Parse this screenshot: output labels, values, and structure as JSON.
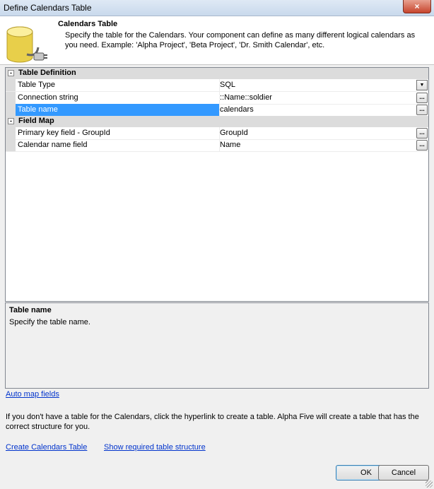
{
  "window": {
    "title": "Define Calendars Table",
    "close_label": "×"
  },
  "header": {
    "title": "Calendars Table",
    "description": "Specify the table for the Calendars. Your component can define as many different logical calendars as you need. Example: 'Alpha Project', 'Beta Project', 'Dr. Smith Calendar', etc."
  },
  "grid": {
    "groups": [
      {
        "label": "Table Definition",
        "toggle": "-",
        "rows": [
          {
            "name": "Table Type",
            "value": "SQL",
            "control": "dropdown"
          },
          {
            "name": "Connection string",
            "value": "::Name::soldier",
            "control": "ellipsis"
          },
          {
            "name": "Table name",
            "value": "calendars",
            "control": "ellipsis",
            "selected": true
          }
        ]
      },
      {
        "label": "Field Map",
        "toggle": "-",
        "rows": [
          {
            "name": "Primary key field - GroupId",
            "value": "GroupId",
            "control": "ellipsis"
          },
          {
            "name": "Calendar name field",
            "value": "Name",
            "control": "ellipsis"
          }
        ]
      }
    ],
    "ellipsis_label": "...",
    "dropdown_label": "▼"
  },
  "help": {
    "title": "Table name",
    "description": "Specify the table name."
  },
  "links": {
    "auto_map": "Auto map fields",
    "create_table": "Create Calendars Table",
    "show_structure": "Show required table structure"
  },
  "note": "If you don't have a table for the Calendars, click the hyperlink to create a table. Alpha Five will create a table that has the correct structure for you.",
  "buttons": {
    "ok": "OK",
    "cancel": "Cancel"
  }
}
